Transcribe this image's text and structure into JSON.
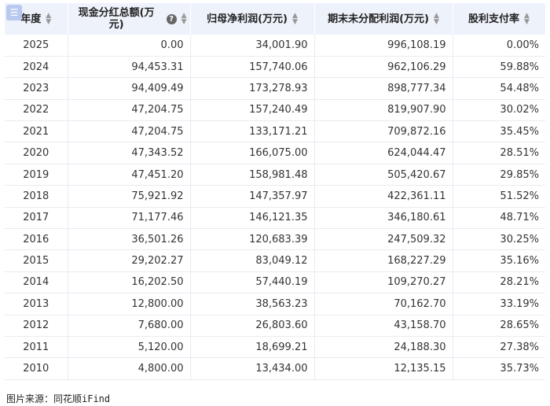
{
  "menu_icon_glyph": "☰",
  "table": {
    "headers": [
      {
        "label": "年度",
        "sortable": true,
        "help": false
      },
      {
        "label": "现金分红总额(万元)",
        "sortable": true,
        "help": true
      },
      {
        "label": "归母净利润(万元)",
        "sortable": true,
        "help": false
      },
      {
        "label": "期末未分配利润(万元)",
        "sortable": true,
        "help": false
      },
      {
        "label": "股利支付率",
        "sortable": true,
        "help": false
      }
    ],
    "rows": [
      [
        "2025",
        "0.00",
        "34,001.90",
        "996,108.19",
        "0.00%"
      ],
      [
        "2024",
        "94,453.31",
        "157,740.06",
        "962,106.29",
        "59.88%"
      ],
      [
        "2023",
        "94,409.49",
        "173,278.93",
        "898,777.34",
        "54.48%"
      ],
      [
        "2022",
        "47,204.75",
        "157,240.49",
        "819,907.90",
        "30.02%"
      ],
      [
        "2021",
        "47,204.75",
        "133,171.21",
        "709,872.16",
        "35.45%"
      ],
      [
        "2020",
        "47,343.52",
        "166,075.00",
        "624,044.47",
        "28.51%"
      ],
      [
        "2019",
        "47,451.20",
        "158,981.48",
        "505,420.67",
        "29.85%"
      ],
      [
        "2018",
        "75,921.92",
        "147,357.97",
        "422,361.11",
        "51.52%"
      ],
      [
        "2017",
        "71,177.46",
        "146,121.35",
        "346,180.61",
        "48.71%"
      ],
      [
        "2016",
        "36,501.26",
        "120,683.39",
        "247,509.32",
        "30.25%"
      ],
      [
        "2015",
        "29,202.27",
        "83,049.12",
        "168,227.29",
        "35.16%"
      ],
      [
        "2014",
        "16,202.50",
        "57,440.19",
        "109,270.27",
        "28.21%"
      ],
      [
        "2013",
        "12,800.00",
        "38,563.23",
        "70,162.70",
        "33.19%"
      ],
      [
        "2012",
        "7,680.00",
        "26,803.60",
        "43,158.70",
        "28.65%"
      ],
      [
        "2011",
        "5,120.00",
        "18,699.21",
        "24,188.30",
        "27.38%"
      ],
      [
        "2010",
        "4,800.00",
        "13,434.00",
        "12,135.15",
        "35.73%"
      ]
    ]
  },
  "source_text": "图片来源：同花顺iFind",
  "colors": {
    "header_bg": "#eef2fb",
    "border": "#e8ebf2",
    "badge": "#b8c8f0"
  }
}
